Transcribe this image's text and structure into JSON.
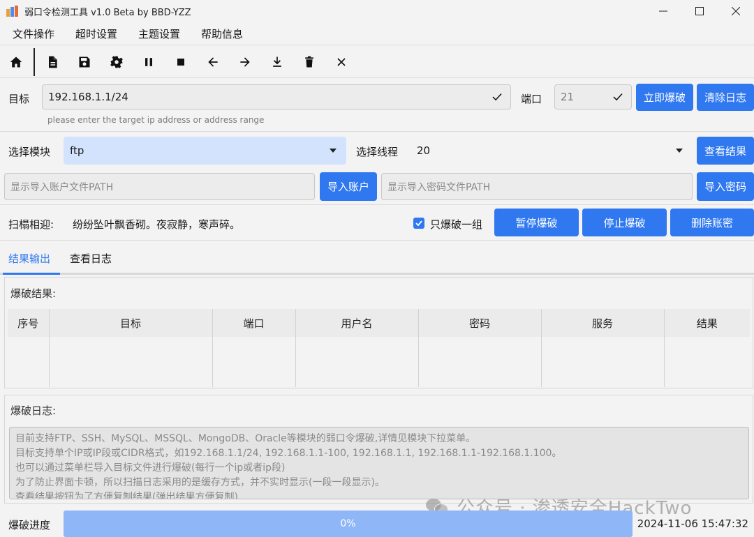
{
  "window": {
    "title": "弱口令检测工具 v1.0 Beta by BBD-YZZ",
    "controls": [
      "minimize-icon",
      "maximize-icon",
      "close-icon"
    ]
  },
  "menu": {
    "items": [
      {
        "label": "文件操作"
      },
      {
        "label": "超时设置"
      },
      {
        "label": "主题设置"
      },
      {
        "label": "帮助信息"
      }
    ]
  },
  "toolbar": {
    "icons": [
      "home-icon",
      "document-icon",
      "save-icon",
      "gear-icon",
      "pause-icon",
      "stop-icon",
      "arrow-left-icon",
      "arrow-right-icon",
      "download-icon",
      "trash-icon",
      "close-icon"
    ]
  },
  "target": {
    "label": "目标",
    "value": "192.168.1.1/24",
    "hint": "please enter the target ip address or address range",
    "port_label": "端口",
    "port_value": "21",
    "start_button": "立即爆破",
    "clear_button": "清除日志"
  },
  "module": {
    "label": "选择模块",
    "selected": "ftp",
    "thread_label": "选择线程",
    "thread_selected": "20",
    "view_result_button": "查看结果"
  },
  "files": {
    "account_placeholder": "显示导入账户文件PATH",
    "import_account_button": "导入账户",
    "password_placeholder": "显示导入密码文件PATH",
    "import_password_button": "导入密码"
  },
  "action": {
    "label": "扫榻相迎:",
    "slogan": "纷纷坠叶飘香砌。夜寂静，寒声碎。",
    "only_one_label": "只爆破一组",
    "only_one_checked": true,
    "pause_button": "暂停爆破",
    "stop_button": "停止爆破",
    "delete_button": "删除账密"
  },
  "tabs": [
    {
      "label": "结果输出",
      "active": true
    },
    {
      "label": "查看日志",
      "active": false
    }
  ],
  "results": {
    "title": "爆破结果:",
    "columns": [
      "序号",
      "目标",
      "端口",
      "用户名",
      "密码",
      "服务",
      "结果"
    ]
  },
  "log": {
    "title": "爆破日志:",
    "lines": [
      "目前支持FTP、SSH、MySQL、MSSQL、MongoDB、Oracle等模块的弱口令爆破,详情见模块下拉菜单。",
      "目标支持单个IP或IP段或CIDR格式，如192.168.1.1/24, 192.168.1.1-100, 192.168.1.1, 192.168.1.1-192.168.1.100。",
      "也可以通过菜单栏导入目标文件进行爆破(每行一个ip或者ip段)",
      "为了防止界面卡顿，所以扫描日志采用的是缓存方式，并不实时显示(一段一段显示)。",
      "查看结果按钮为了方便复制结果(弹出结果方便复制)"
    ]
  },
  "progress": {
    "label": "爆破进度",
    "percent": 0,
    "text": "0%",
    "datetime": "2024-11-06 15:47:32"
  },
  "watermark": {
    "text": "公众号 · 渗透安全HackTwo"
  },
  "colors": {
    "accent": "#2f78f0",
    "selected_bg": "#d3e3fd",
    "progress_bg": "#8fb6f6"
  }
}
